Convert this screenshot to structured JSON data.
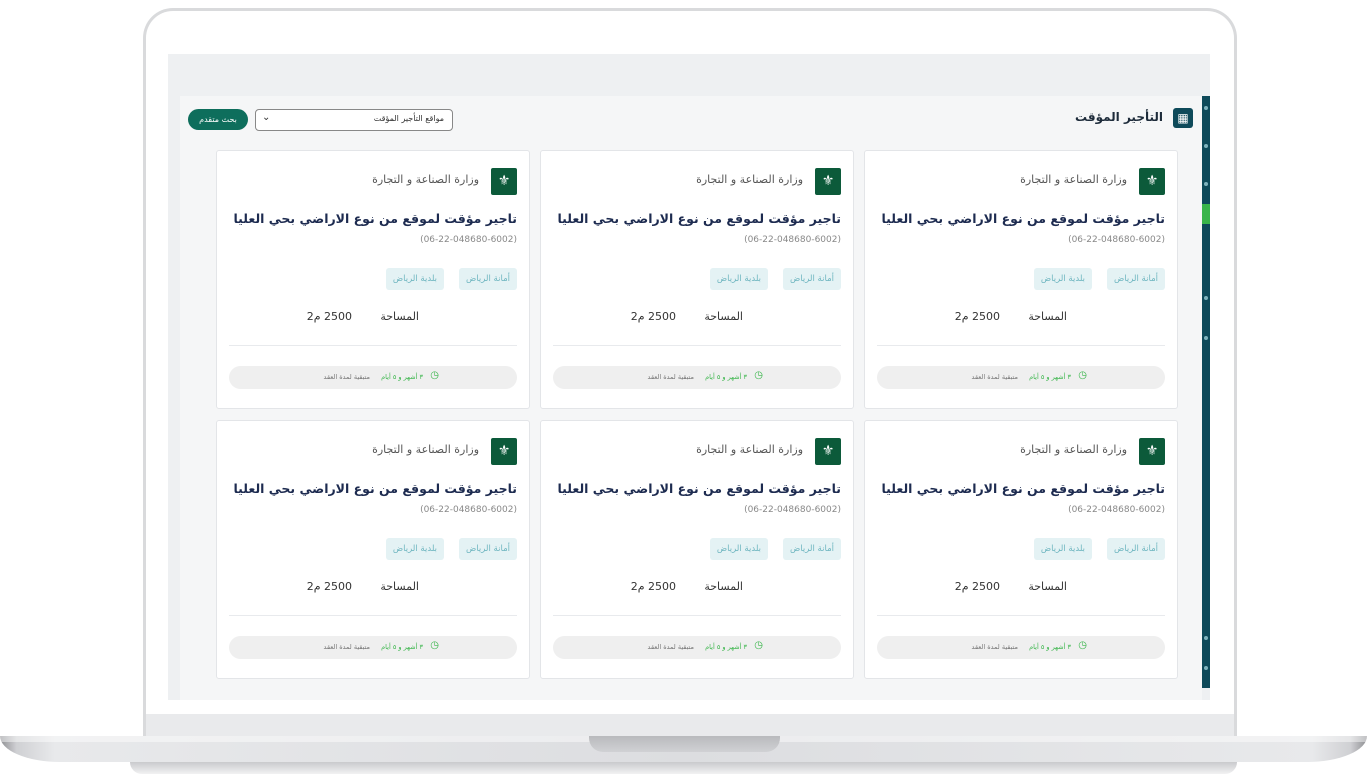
{
  "header": {
    "title": "التأجير المؤقت",
    "title_icon": "building-icon",
    "select_value": "مواقع التأجير المؤقت",
    "select_chevron": "⌄",
    "advanced_search_label": "بحث متقدم"
  },
  "cards": [
    {
      "org": "وزارة الصناعة و التجارة",
      "title": "تاجير مؤقت لموقع من نوع الاراضي بحي العليا",
      "code": "(06-22-048680-6002)",
      "tag1": "أمانة الرياض",
      "tag2": "بلدية الرياض",
      "area_label": "المساحة",
      "area_value": "2500 م2",
      "remaining": "٣ أشهر و ٥ أيام",
      "remaining_suffix": "متبقية لمدة العقد"
    },
    {
      "org": "وزارة الصناعة و التجارة",
      "title": "تاجير مؤقت لموقع من نوع الاراضي بحي العليا",
      "code": "(06-22-048680-6002)",
      "tag1": "أمانة الرياض",
      "tag2": "بلدية الرياض",
      "area_label": "المساحة",
      "area_value": "2500 م2",
      "remaining": "٣ أشهر و ٥ أيام",
      "remaining_suffix": "متبقية لمدة العقد"
    },
    {
      "org": "وزارة الصناعة و التجارة",
      "title": "تاجير مؤقت لموقع من نوع الاراضي بحي العليا",
      "code": "(06-22-048680-6002)",
      "tag1": "أمانة الرياض",
      "tag2": "بلدية الرياض",
      "area_label": "المساحة",
      "area_value": "2500 م2",
      "remaining": "٣ أشهر و ٥ أيام",
      "remaining_suffix": "متبقية لمدة العقد"
    },
    {
      "org": "وزارة الصناعة و التجارة",
      "title": "تاجير مؤقت لموقع من نوع الاراضي بحي العليا",
      "code": "(06-22-048680-6002)",
      "tag1": "أمانة الرياض",
      "tag2": "بلدية الرياض",
      "area_label": "المساحة",
      "area_value": "2500 م2",
      "remaining": "٣ أشهر و ٥ أيام",
      "remaining_suffix": "متبقية لمدة العقد"
    },
    {
      "org": "وزارة الصناعة و التجارة",
      "title": "تاجير مؤقت لموقع من نوع الاراضي بحي العليا",
      "code": "(06-22-048680-6002)",
      "tag1": "أمانة الرياض",
      "tag2": "بلدية الرياض",
      "area_label": "المساحة",
      "area_value": "2500 م2",
      "remaining": "٣ أشهر و ٥ أيام",
      "remaining_suffix": "متبقية لمدة العقد"
    },
    {
      "org": "وزارة الصناعة و التجارة",
      "title": "تاجير مؤقت لموقع من نوع الاراضي بحي العليا",
      "code": "(06-22-048680-6002)",
      "tag1": "أمانة الرياض",
      "tag2": "بلدية الرياض",
      "area_label": "المساحة",
      "area_value": "2500 م2",
      "remaining": "٣ أشهر و ٥ أيام",
      "remaining_suffix": "متبقية لمدة العقد"
    }
  ],
  "icons": {
    "logo": "saudi-emblem-icon",
    "clock": "clock-icon",
    "chevron": "chevron-down-icon"
  },
  "colors": {
    "primary": "#0e4a5a",
    "accent": "#39b54a",
    "button": "#0e6e5c",
    "tag_bg": "#e4f2f4"
  }
}
